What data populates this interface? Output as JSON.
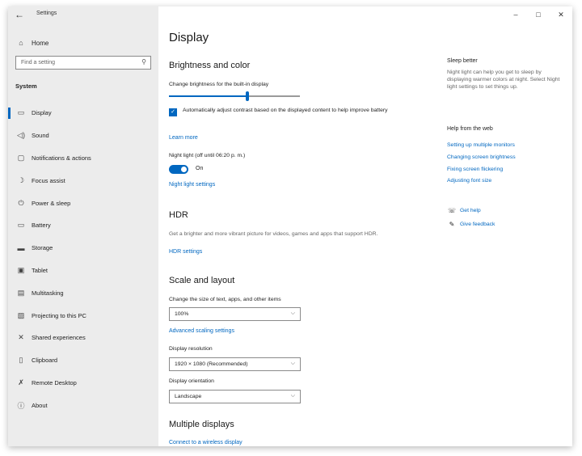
{
  "window": {
    "title": "Settings"
  },
  "titlebar": {
    "back": "←",
    "minimize": "–",
    "maximize": "□",
    "close": "✕"
  },
  "sidebar": {
    "home_label": "Home",
    "search_placeholder": "Find a setting",
    "section_label": "System",
    "items": [
      {
        "label": "Display",
        "icon": "monitor-icon",
        "glyph": "▭",
        "selected": true
      },
      {
        "label": "Sound",
        "icon": "speaker-icon",
        "glyph": "◁)"
      },
      {
        "label": "Notifications & actions",
        "icon": "notification-icon",
        "glyph": "▢"
      },
      {
        "label": "Focus assist",
        "icon": "moon-icon",
        "glyph": "☽"
      },
      {
        "label": "Power & sleep",
        "icon": "power-icon",
        "glyph": "⏻"
      },
      {
        "label": "Battery",
        "icon": "battery-icon",
        "glyph": "▭"
      },
      {
        "label": "Storage",
        "icon": "storage-icon",
        "glyph": "▬"
      },
      {
        "label": "Tablet",
        "icon": "tablet-icon",
        "glyph": "▣"
      },
      {
        "label": "Multitasking",
        "icon": "multitasking-icon",
        "glyph": "▤"
      },
      {
        "label": "Projecting to this PC",
        "icon": "projecting-icon",
        "glyph": "▧"
      },
      {
        "label": "Shared experiences",
        "icon": "shared-experiences-icon",
        "glyph": "✕"
      },
      {
        "label": "Clipboard",
        "icon": "clipboard-icon",
        "glyph": "▯"
      },
      {
        "label": "Remote Desktop",
        "icon": "remote-desktop-icon",
        "glyph": "✗"
      },
      {
        "label": "About",
        "icon": "info-icon",
        "glyph": "ⓘ"
      }
    ]
  },
  "main": {
    "title": "Display",
    "brightness": {
      "heading": "Brightness and color",
      "slider_label": "Change brightness for the built-in display",
      "slider_value": 0.6,
      "checkbox_label": "Automatically adjust contrast based on the displayed content to help improve battery",
      "checkbox_checked": true,
      "learn_more": "Learn more",
      "night_light_label": "Night light (off until 06:20 p. m.)",
      "night_light_state": "On",
      "night_light_settings": "Night light settings"
    },
    "hdr": {
      "heading": "HDR",
      "description": "Get a brighter and more vibrant picture for videos, games and apps that support HDR.",
      "settings_link": "HDR settings"
    },
    "scale": {
      "heading": "Scale and layout",
      "size_label": "Change the size of text, apps, and other items",
      "size_value": "100%",
      "advanced_link": "Advanced scaling settings",
      "resolution_label": "Display resolution",
      "resolution_value": "1920 × 1080 (Recommended)",
      "orientation_label": "Display orientation",
      "orientation_value": "Landscape"
    },
    "multiple": {
      "heading": "Multiple displays",
      "connect_link": "Connect to a wireless display"
    }
  },
  "right_panel": {
    "sleep_heading": "Sleep better",
    "sleep_desc": "Night light can help you get to sleep by displaying warmer colors at night. Select Night light settings to set things up.",
    "help_heading": "Help from the web",
    "help_links": [
      "Setting up multiple monitors",
      "Changing screen brightness",
      "Fixing screen flickering",
      "Adjusting font size"
    ],
    "get_help": "Get help",
    "give_feedback": "Give feedback"
  },
  "colors": {
    "accent": "#0067c0",
    "sidebar_bg": "#ececec"
  }
}
